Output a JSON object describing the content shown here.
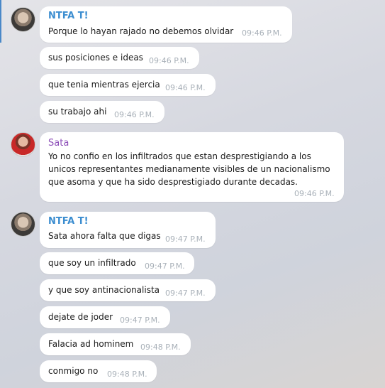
{
  "messages": [
    {
      "sender": "NTFA T!",
      "text": "Porque lo hayan rajado no debemos olvidar",
      "time": "09:46 P.M."
    },
    {
      "text": "sus posiciones e ideas",
      "time": "09:46 P.M."
    },
    {
      "text": "que tenia mientras ejercia",
      "time": "09:46 P.M."
    },
    {
      "text": "su trabajo ahi",
      "time": "09:46 P.M."
    },
    {
      "sender": "Sata",
      "text": "Yo no confio en los infiltrados que estan desprestigiando a los unicos representantes medianamente visibles de un nacionalismo que asoma y que ha sido desprestigiado durante decadas.",
      "time": "09:46 P.M."
    },
    {
      "sender": "NTFA T!",
      "text": "Sata ahora falta que digas",
      "time": "09:47 P.M."
    },
    {
      "text": "que soy un infiltrado",
      "time": "09:47 P.M."
    },
    {
      "text": "y que soy antinacionalista",
      "time": "09:47 P.M."
    },
    {
      "text": "dejate de joder",
      "time": "09:47 P.M."
    },
    {
      "text": "Falacia ad hominem",
      "time": "09:48 P.M."
    },
    {
      "text": "conmigo no",
      "time": "09:48 P.M."
    }
  ]
}
